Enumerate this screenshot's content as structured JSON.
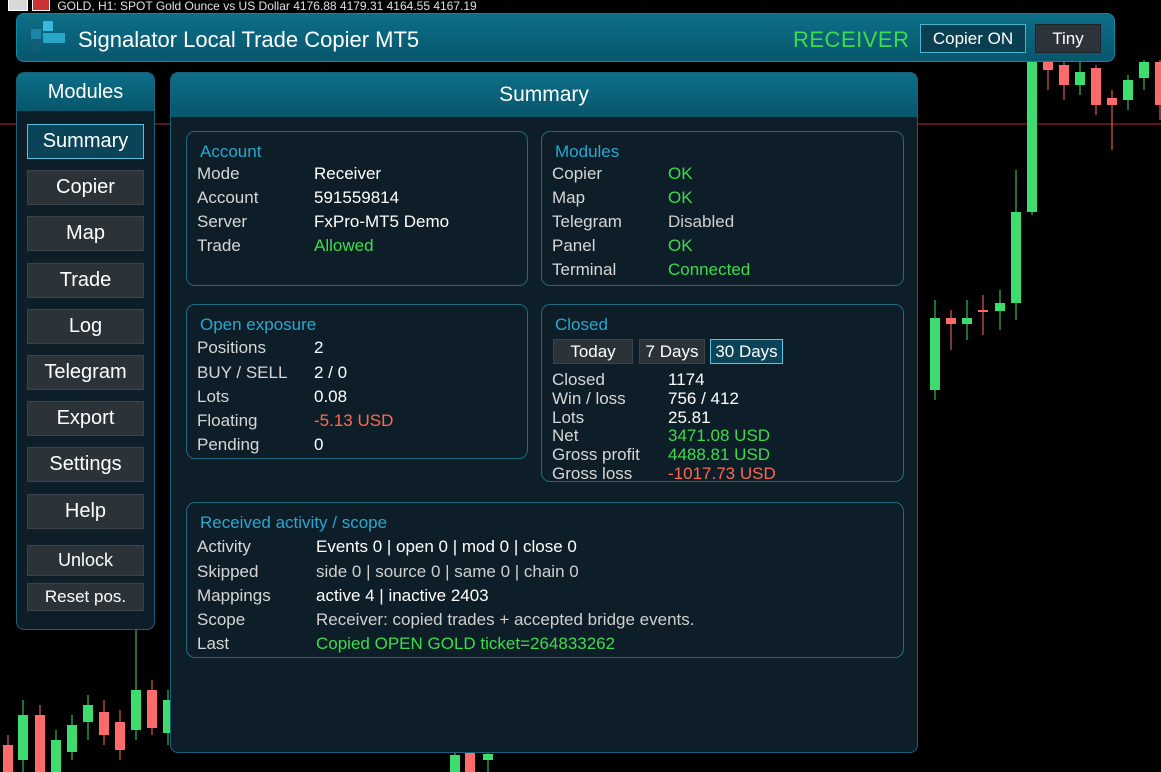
{
  "chart": {
    "title": "GOLD, H1:  SPOT Gold Ounce vs US Dollar  4176.88 4179.31 4164.55 4167.19",
    "up_color": "#3ddc6e",
    "down_color": "#ff6b6b"
  },
  "header": {
    "app_title": "Signalator Local Trade Copier MT5",
    "mode": "RECEIVER",
    "copier_button": "Copier ON",
    "tiny_button": "Tiny",
    "accent_color": "#0d6f87",
    "ok_color": "#3ddc4a",
    "negative_color": "#ff6a4c"
  },
  "sidebar": {
    "title": "Modules",
    "items": [
      {
        "label": "Summary",
        "active": true
      },
      {
        "label": "Copier"
      },
      {
        "label": "Map"
      },
      {
        "label": "Trade"
      },
      {
        "label": "Log"
      },
      {
        "label": "Telegram"
      },
      {
        "label": "Export"
      },
      {
        "label": "Settings"
      },
      {
        "label": "Help"
      }
    ],
    "unlock_label": "Unlock",
    "reset_label": "Reset pos."
  },
  "summary": {
    "title": "Summary",
    "account": {
      "title": "Account",
      "rows": [
        {
          "label": "Mode",
          "value": "Receiver"
        },
        {
          "label": "Account",
          "value": "591559814"
        },
        {
          "label": "Server",
          "value": "FxPro-MT5 Demo"
        },
        {
          "label": "Trade",
          "value": "Allowed"
        }
      ]
    },
    "modules": {
      "title": "Modules",
      "rows": [
        {
          "label": "Copier",
          "value": "OK"
        },
        {
          "label": "Map",
          "value": "OK"
        },
        {
          "label": "Telegram",
          "value": "Disabled"
        },
        {
          "label": "Panel",
          "value": "OK"
        },
        {
          "label": "Terminal",
          "value": "Connected"
        }
      ]
    },
    "exposure": {
      "title": "Open exposure",
      "rows": [
        {
          "label": "Positions",
          "value": "2"
        },
        {
          "label": "BUY / SELL",
          "value": "2 / 0"
        },
        {
          "label": "Lots",
          "value": "0.08"
        },
        {
          "label": "Floating",
          "value": "-5.13 USD"
        },
        {
          "label": "Pending",
          "value": "0"
        }
      ]
    },
    "closed": {
      "title": "Closed",
      "periods": [
        "Today",
        "7 Days",
        "30 Days"
      ],
      "active_period": "30 Days",
      "rows": [
        {
          "label": "Closed",
          "value": "1174"
        },
        {
          "label": "Win / loss",
          "value": "756 / 412"
        },
        {
          "label": "Lots",
          "value": "25.81"
        },
        {
          "label": "Net",
          "value": "3471.08 USD"
        },
        {
          "label": "Gross profit",
          "value": "4488.81 USD"
        },
        {
          "label": "Gross loss",
          "value": "-1017.73 USD"
        }
      ]
    },
    "activity": {
      "title": "Received activity / scope",
      "rows": [
        {
          "label": "Activity",
          "value": "Events 0 | open 0 | mod 0 | close 0"
        },
        {
          "label": "Skipped",
          "value": "side 0 | source 0 | same 0 | chain 0"
        },
        {
          "label": "Mappings",
          "value": "active 4 | inactive 2403"
        },
        {
          "label": "Scope",
          "value": "Receiver: copied trades + accepted bridge events."
        },
        {
          "label": "Last",
          "value": "Copied OPEN GOLD ticket=264833262"
        }
      ]
    }
  }
}
